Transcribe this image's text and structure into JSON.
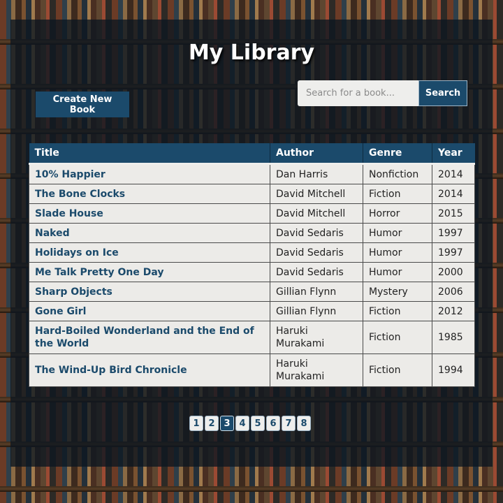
{
  "app": {
    "title": "My Library"
  },
  "toolbar": {
    "create_label": "Create New Book",
    "search_placeholder": "Search for a book...",
    "search_value": "",
    "search_label": "Search"
  },
  "table": {
    "headers": [
      "Title",
      "Author",
      "Genre",
      "Year"
    ],
    "rows": [
      {
        "title": "10% Happier",
        "author": "Dan Harris",
        "genre": "Nonfiction",
        "year": "2014"
      },
      {
        "title": "The Bone Clocks",
        "author": "David Mitchell",
        "genre": "Fiction",
        "year": "2014"
      },
      {
        "title": "Slade House",
        "author": "David Mitchell",
        "genre": "Horror",
        "year": "2015"
      },
      {
        "title": "Naked",
        "author": "David Sedaris",
        "genre": "Humor",
        "year": "1997"
      },
      {
        "title": "Holidays on Ice",
        "author": "David Sedaris",
        "genre": "Humor",
        "year": "1997"
      },
      {
        "title": "Me Talk Pretty One Day",
        "author": "David Sedaris",
        "genre": "Humor",
        "year": "2000"
      },
      {
        "title": "Sharp Objects",
        "author": "Gillian Flynn",
        "genre": "Mystery",
        "year": "2006"
      },
      {
        "title": "Gone Girl",
        "author": "Gillian Flynn",
        "genre": "Fiction",
        "year": "2012"
      },
      {
        "title": "Hard-Boiled Wonderland and the End of the World",
        "author": "Haruki Murakami",
        "genre": "Fiction",
        "year": "1985"
      },
      {
        "title": "The Wind-Up Bird Chronicle",
        "author": "Haruki Murakami",
        "genre": "Fiction",
        "year": "1994"
      }
    ]
  },
  "pagination": {
    "pages": [
      "1",
      "2",
      "3",
      "4",
      "5",
      "6",
      "7",
      "8"
    ],
    "current": "3"
  },
  "colors": {
    "accent": "#1b4a6b",
    "row_background": "#ecebe8",
    "overlay": "#0c1620"
  }
}
